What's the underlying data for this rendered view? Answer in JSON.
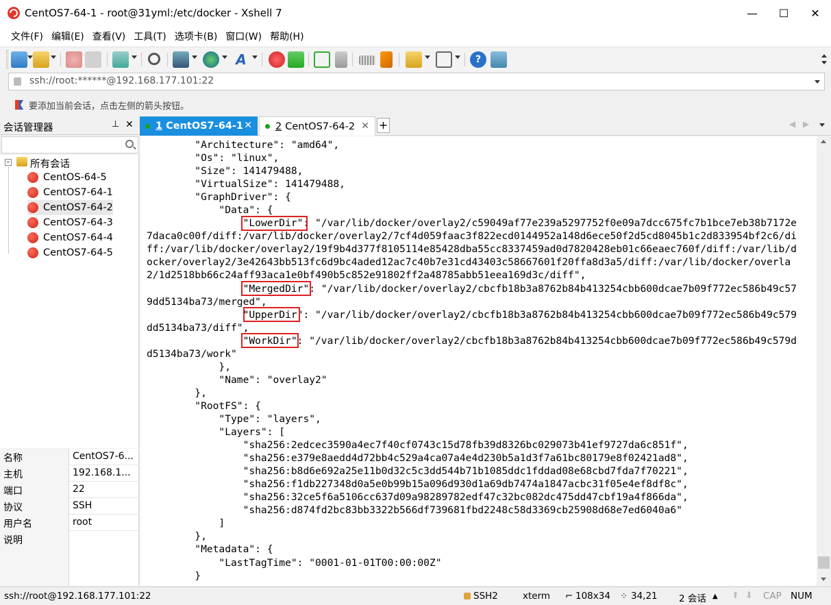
{
  "window": {
    "title": "CentOS7-64-1 - root@31yml:/etc/docker - Xshell 7",
    "minimize": "—",
    "maximize": "☐",
    "close": "✕"
  },
  "menu": [
    "文件(F)",
    "编辑(E)",
    "查看(V)",
    "工具(T)",
    "选项卡(B)",
    "窗口(W)",
    "帮助(H)"
  ],
  "address": {
    "value": "ssh://root:******@192.168.177.101:22"
  },
  "hint": "要添加当前会话，点击左侧的箭头按钮。",
  "session_manager": {
    "title": "会话管理器",
    "pin": "ᵖ",
    "close": "✕",
    "root": "所有会话",
    "sessions": [
      "CentOS-64-5",
      "CentOS7-64-1",
      "CentOS7-64-2",
      "CentOS7-64-3",
      "CentOS7-64-4",
      "CentOS7-64-5"
    ],
    "properties": [
      {
        "key": "名称",
        "value": "CentOS7-6..."
      },
      {
        "key": "主机",
        "value": "192.168.1..."
      },
      {
        "key": "端口",
        "value": "22"
      },
      {
        "key": "协议",
        "value": "SSH"
      },
      {
        "key": "用户名",
        "value": "root"
      },
      {
        "key": "说明",
        "value": ""
      }
    ]
  },
  "tabs": [
    {
      "num": "1",
      "label": "CentOS7-64-1",
      "close": "✕"
    },
    {
      "num": "2",
      "label": "CentOS7-64-2",
      "close": "✕"
    }
  ],
  "tab_add": "+",
  "terminal": {
    "lines": [
      "        \"Architecture\": \"amd64\",",
      "        \"Os\": \"linux\",",
      "        \"Size\": 141479488,",
      "        \"VirtualSize\": 141479488,",
      "        \"GraphDriver\": {",
      "            \"Data\": {",
      "                \"LowerDir\": \"/var/lib/docker/overlay2/c59049af77e239a5297752f0e09a7dcc675fc7b1bce7eb38b7172e",
      "7daca0c00f/diff:/var/lib/docker/overlay2/7cf4d059faac3f822ecd0144952a148d6ece50f2d5cd8045b1c2d833954bf2c6/di",
      "ff:/var/lib/docker/overlay2/19f9b4d377f8105114e85428dba55cc8337459ad0d7820428eb01c66eaec760f/diff:/var/lib/d",
      "ocker/overlay2/3e42643bb513fc6d9bc4aded12ac7c40b7e31cd43403c58667601f20ffa8d3a5/diff:/var/lib/docker/overla",
      "2/1d2518bb66c24aff93aca1e0bf490b5c852e91802ff2a48785abb51eea169d3c/diff\",",
      "                \"MergedDir\": \"/var/lib/docker/overlay2/cbcfb18b3a8762b84b413254cbb600dcae7b09f772ec586b49c57",
      "9dd5134ba73/merged\",",
      "                \"UpperDir\": \"/var/lib/docker/overlay2/cbcfb18b3a8762b84b413254cbb600dcae7b09f772ec586b49c579",
      "dd5134ba73/diff\",",
      "                \"WorkDir\": \"/var/lib/docker/overlay2/cbcfb18b3a8762b84b413254cbb600dcae7b09f772ec586b49c579d",
      "d5134ba73/work\"",
      "            },",
      "            \"Name\": \"overlay2\"",
      "        },",
      "        \"RootFS\": {",
      "            \"Type\": \"layers\",",
      "            \"Layers\": [",
      "                \"sha256:2edcec3590a4ec7f40cf0743c15d78fb39d8326bc029073b41ef9727da6c851f\",",
      "                \"sha256:e379e8aedd4d72bb4c529a4ca07a4e4d230b5a1d3f7a61bc80179e8f02421ad8\",",
      "                \"sha256:b8d6e692a25e11b0d32c5c3dd544b71b1085ddc1fddad08e68cbd7fda7f70221\",",
      "                \"sha256:f1db227348d0a5e0b99b15a096d930d1a69db7474a1847acbc31f05e4ef8df8c\",",
      "                \"sha256:32ce5f6a5106cc637d09a98289782edf47c32bc082dc475dd47cbf19a4f866da\",",
      "                \"sha256:d874fd2bc83bb3322b566df739681fbd2248c58d3369cb25908d68e7ed6040a6\"",
      "            ]",
      "        },",
      "        \"Metadata\": {",
      "            \"LastTagTime\": \"0001-01-01T00:00:00Z\"",
      "        }"
    ]
  },
  "status": {
    "connection": "ssh://root@192.168.177.101:22",
    "protocol": "SSH2",
    "term": "xterm",
    "size": "108x34",
    "cursor": "34,21",
    "sessions": "2 会话",
    "cap": "CAP",
    "num": "NUM"
  },
  "colors": {
    "accent": "#0b76cf",
    "active_tab": "#1a8fe0",
    "highlight_box": "#e02020",
    "session_icon": "#d8321f"
  }
}
